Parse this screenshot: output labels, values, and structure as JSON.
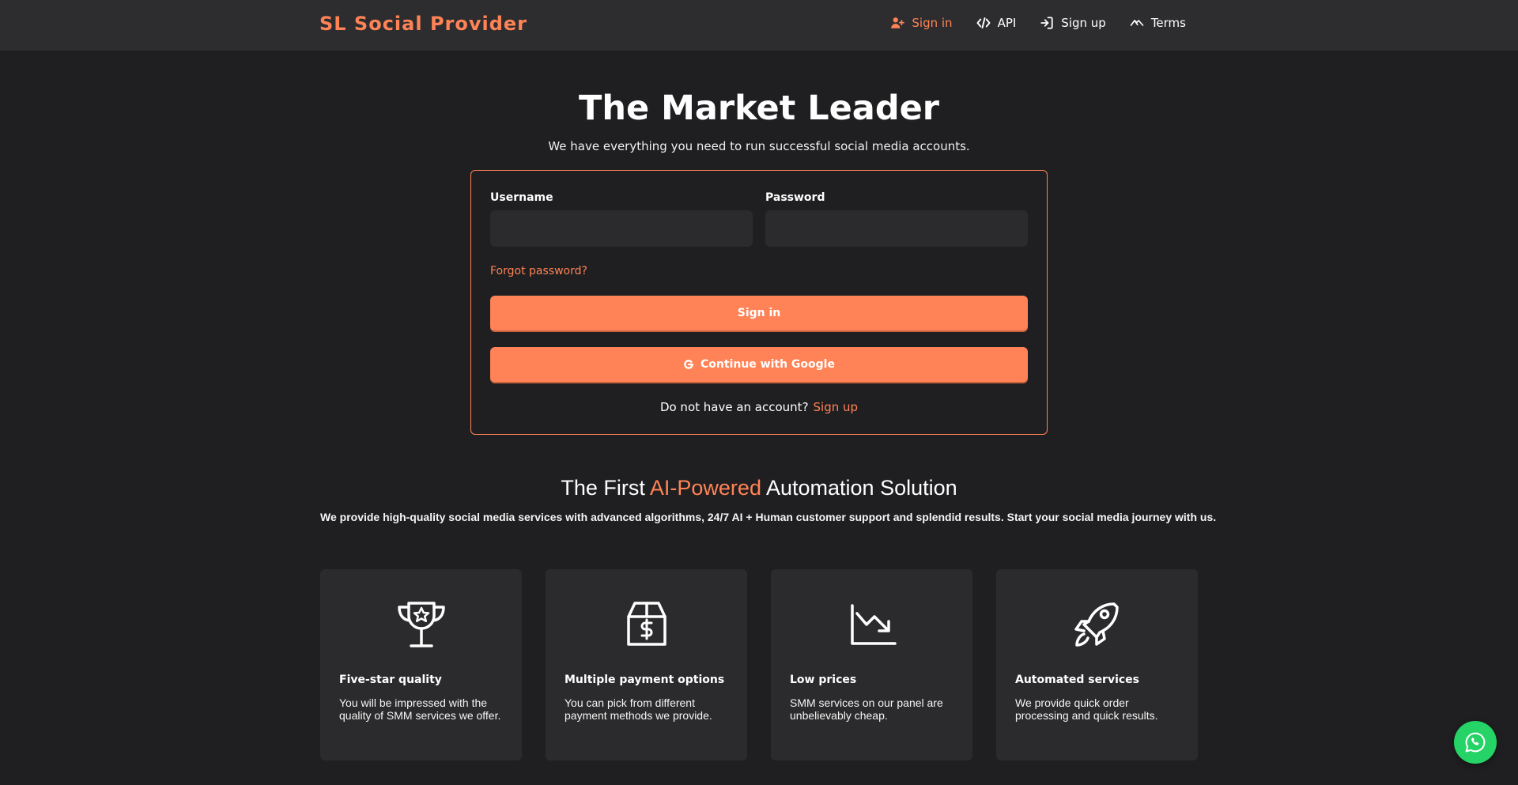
{
  "brand": "SL Social Provider",
  "nav": [
    {
      "label": "Sign in",
      "icon": "user-plus-icon",
      "active": true
    },
    {
      "label": "API",
      "icon": "code-icon",
      "active": false
    },
    {
      "label": "Sign up",
      "icon": "sign-in-arrow-icon",
      "active": false
    },
    {
      "label": "Terms",
      "icon": "hand-shake-icon",
      "active": false
    }
  ],
  "hero": {
    "title": "The Market Leader",
    "subtitle": "We have everything you need to run successful social media accounts."
  },
  "login": {
    "username_label": "Username",
    "username_value": "",
    "password_label": "Password",
    "password_value": "",
    "forgot": "Forgot password?",
    "signin_button": "Sign in",
    "google_button": "Continue with Google",
    "no_account_text": "Do not have an account?",
    "signup_link": "Sign up"
  },
  "section": {
    "title_pre": "The First ",
    "title_accent": "AI-Powered",
    "title_post": " Automation Solution",
    "subtitle": "We provide high-quality social media services with advanced algorithms, 24/7 AI + Human customer support and splendid results. Start your social media journey with us."
  },
  "features": [
    {
      "icon": "trophy-icon",
      "title": "Five-star quality",
      "text": "You will be impressed with the quality of SMM services we offer."
    },
    {
      "icon": "dollar-box-icon",
      "title": "Multiple payment options",
      "text": "You can pick from different payment methods we provide."
    },
    {
      "icon": "chart-down-icon",
      "title": "Low prices",
      "text": "SMM services on our panel are unbelievably cheap."
    },
    {
      "icon": "rocket-icon",
      "title": "Automated services",
      "text": "We provide quick order processing and quick results."
    }
  ],
  "colors": {
    "accent": "#ff8356",
    "background": "#1f1f21",
    "header": "#2d2d2f",
    "card": "#2b2b2d",
    "whatsapp": "#25d366"
  }
}
